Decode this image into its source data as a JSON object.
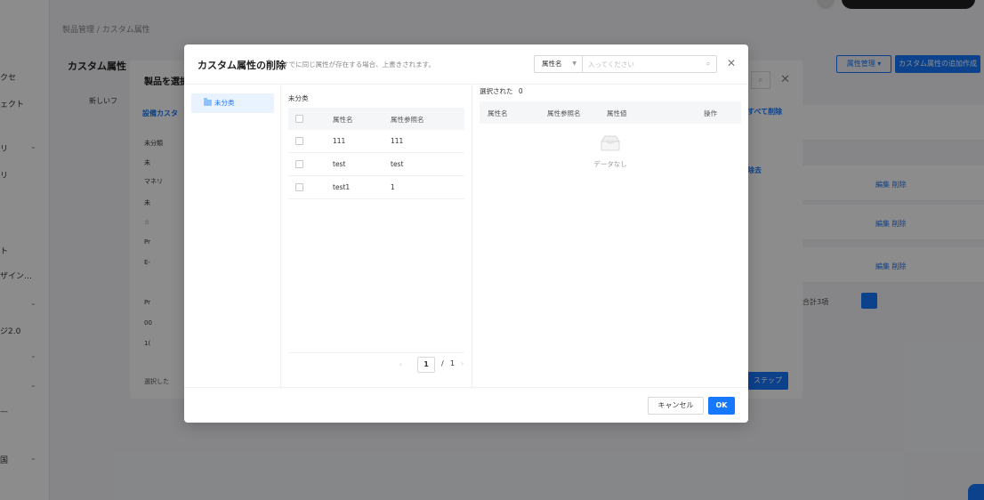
{
  "background": {
    "breadcrumb": "製品管理 / カスタム属性",
    "page_title": "カスタム属性",
    "header_btn_outline": "属性管理 ▾",
    "header_btn_primary": "カスタム属性の追加作成",
    "sidebar_items": [
      "クセ",
      "ェクト",
      "リ",
      "リ",
      "ト",
      "ザイン…",
      "ジ2.0",
      "—",
      "国"
    ],
    "row_actions": [
      "編集 削除",
      "編集 削除",
      "編集 削除"
    ],
    "pager_text": "合計3項"
  },
  "middle_modal": {
    "title": "製品を選択",
    "new_btn": "新しいフ",
    "tab_label": "設備カスタ",
    "tree_items": [
      "未分類",
      "未",
      "マネリ",
      "未",
      "☆",
      "Pr",
      "E-",
      "",
      "Pr",
      "00",
      "1(",
      ""
    ],
    "link_all": "すべて削除",
    "link_remove": "除去",
    "step_btn": "ステップ",
    "footer_check": "選択した"
  },
  "modal": {
    "title": "カスタム属性の削除",
    "subtitle": "すでに同じ属性が存在する場合、上書きされます。",
    "search": {
      "select_value": "属性名",
      "placeholder": "入ってください"
    },
    "category": {
      "label": "未分类"
    },
    "list": {
      "title": "未分类",
      "headers": {
        "name": "属性名",
        "ref_name": "属性参照名"
      },
      "rows": [
        {
          "name": "111",
          "ref_name": "111"
        },
        {
          "name": "test",
          "ref_name": "test"
        },
        {
          "name": "test1",
          "ref_name": "1"
        }
      ],
      "pager": {
        "current": "1",
        "slash": "/",
        "total": "1"
      }
    },
    "selected": {
      "title": "選択された",
      "count": "0",
      "headers": {
        "name": "属性名",
        "ref_name": "属性参照名",
        "value": "属性値",
        "action": "操作"
      },
      "empty_text": "データなし"
    },
    "footer": {
      "cancel_label": "キャンセル",
      "ok_label": "OK"
    }
  }
}
